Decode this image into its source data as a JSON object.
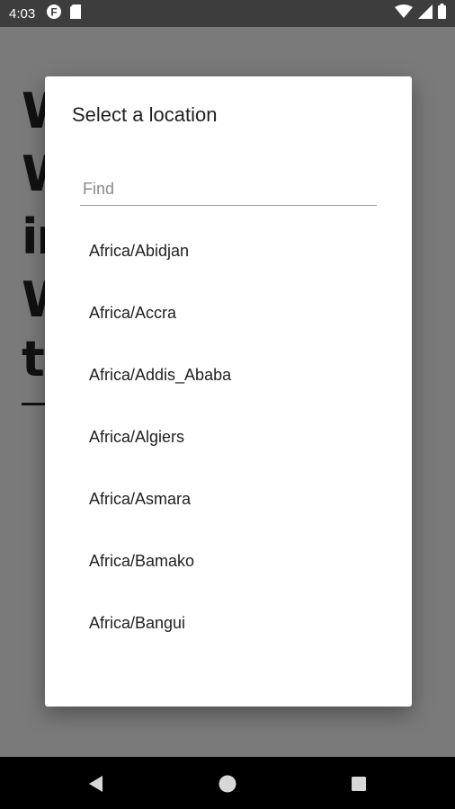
{
  "status_bar": {
    "time": "4:03",
    "left_icons": [
      "notification-f-icon",
      "sd-card-icon"
    ],
    "right_icons": [
      "wifi-icon",
      "signal-icon",
      "battery-icon"
    ]
  },
  "dialog": {
    "title": "Select a location",
    "search": {
      "placeholder": "Find",
      "value": ""
    },
    "items": [
      "Africa/Abidjan",
      "Africa/Accra",
      "Africa/Addis_Ababa",
      "Africa/Algiers",
      "Africa/Asmara",
      "Africa/Bamako",
      "Africa/Bangui"
    ]
  },
  "nav_bar": {
    "buttons": [
      "back-icon",
      "home-icon",
      "recents-icon"
    ]
  }
}
